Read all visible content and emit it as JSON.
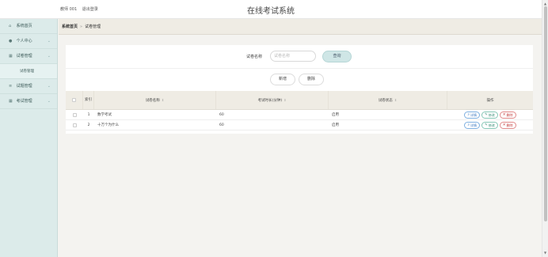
{
  "header": {
    "user": "教师 001",
    "logout": "退出登录",
    "title": "在线考试系统"
  },
  "sidebar": {
    "items": [
      {
        "label": "系统首页",
        "icon": "home-icon",
        "glyph": "⌂",
        "expandable": false
      },
      {
        "label": "个人中心",
        "icon": "user-icon",
        "glyph": "●",
        "expandable": true
      },
      {
        "label": "试卷管理",
        "icon": "grid-icon",
        "glyph": "▦",
        "expandable": true
      },
      {
        "label": "试卷管理",
        "icon": "",
        "glyph": "",
        "expandable": false,
        "sub": true
      },
      {
        "label": "试题管理",
        "icon": "list-icon",
        "glyph": "≡",
        "expandable": true
      },
      {
        "label": "考试管理",
        "icon": "grid-icon",
        "glyph": "▦",
        "expandable": true
      }
    ]
  },
  "breadcrumb": {
    "home": "系统首页",
    "separator": "»",
    "current": "试卷管理"
  },
  "search": {
    "label": "试卷名称",
    "placeholder": "试卷名称",
    "value": "",
    "query_button": "查询"
  },
  "actions": {
    "add": "新增",
    "delete": "删除"
  },
  "table": {
    "columns": {
      "index": "索引",
      "name": "试卷名称",
      "time": "考试时长(分钟)",
      "status": "试卷状态",
      "ops": "操作"
    },
    "sort_glyph": "⇕",
    "rows": [
      {
        "index": "1",
        "name": "数学考试",
        "time": "60",
        "status": "启用"
      },
      {
        "index": "2",
        "name": "十万个为什么",
        "time": "60",
        "status": "启用"
      }
    ],
    "op_labels": {
      "detail": "详情",
      "edit": "修改",
      "delete": "删除"
    }
  },
  "colors": {
    "sidebar_bg": "#dcebea",
    "header_bar_bg": "#efece4",
    "query_button": "#cfe6e6",
    "detail": "#3a78c0",
    "edit": "#3a8f7a",
    "delete": "#c03a3a"
  }
}
